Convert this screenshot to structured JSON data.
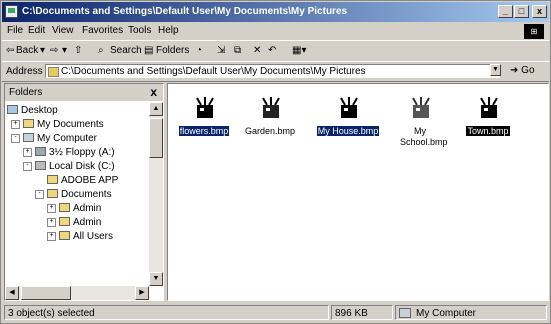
{
  "window": {
    "title": "C:\\Documents and Settings\\Default User\\My Documents\\My Pictures",
    "min_glyph": "_",
    "max_glyph": "□",
    "close_glyph": "x"
  },
  "menu": {
    "items": [
      "File",
      "Edit",
      "View",
      "Favorites",
      "Tools",
      "Help"
    ]
  },
  "toolbar": {
    "back": "Back",
    "search": "Search",
    "folders": "Folders"
  },
  "address": {
    "label": "Address",
    "value": "C:\\Documents and Settings\\Default User\\My Documents\\My Pictures",
    "go": "Go"
  },
  "folders_pane": {
    "title": "Folders",
    "close": "x",
    "tree": [
      {
        "label": "Desktop",
        "expander": ""
      },
      {
        "label": "My Documents",
        "expander": "+"
      },
      {
        "label": "My Computer",
        "expander": "-"
      },
      {
        "label": "3½ Floppy (A:)",
        "expander": "+"
      },
      {
        "label": "Local Disk (C:)",
        "expander": "-"
      },
      {
        "label": "ADOBE APP",
        "expander": ""
      },
      {
        "label": "Documents",
        "expander": "-"
      },
      {
        "label": "Admin",
        "expander": "+"
      },
      {
        "label": "Admin",
        "expander": "+"
      },
      {
        "label": "All Users",
        "expander": "+"
      }
    ]
  },
  "files": [
    {
      "name": "flowers.bmp",
      "selected": true
    },
    {
      "name": "Garden.bmp",
      "selected": false
    },
    {
      "name": "My House.bmp",
      "selected": true
    },
    {
      "name": "My School.bmp",
      "selected": false
    },
    {
      "name": "Town.bmp",
      "selected": false
    }
  ],
  "status": {
    "selection": "3 object(s) selected",
    "size": "896 KB",
    "location": "My Computer"
  }
}
